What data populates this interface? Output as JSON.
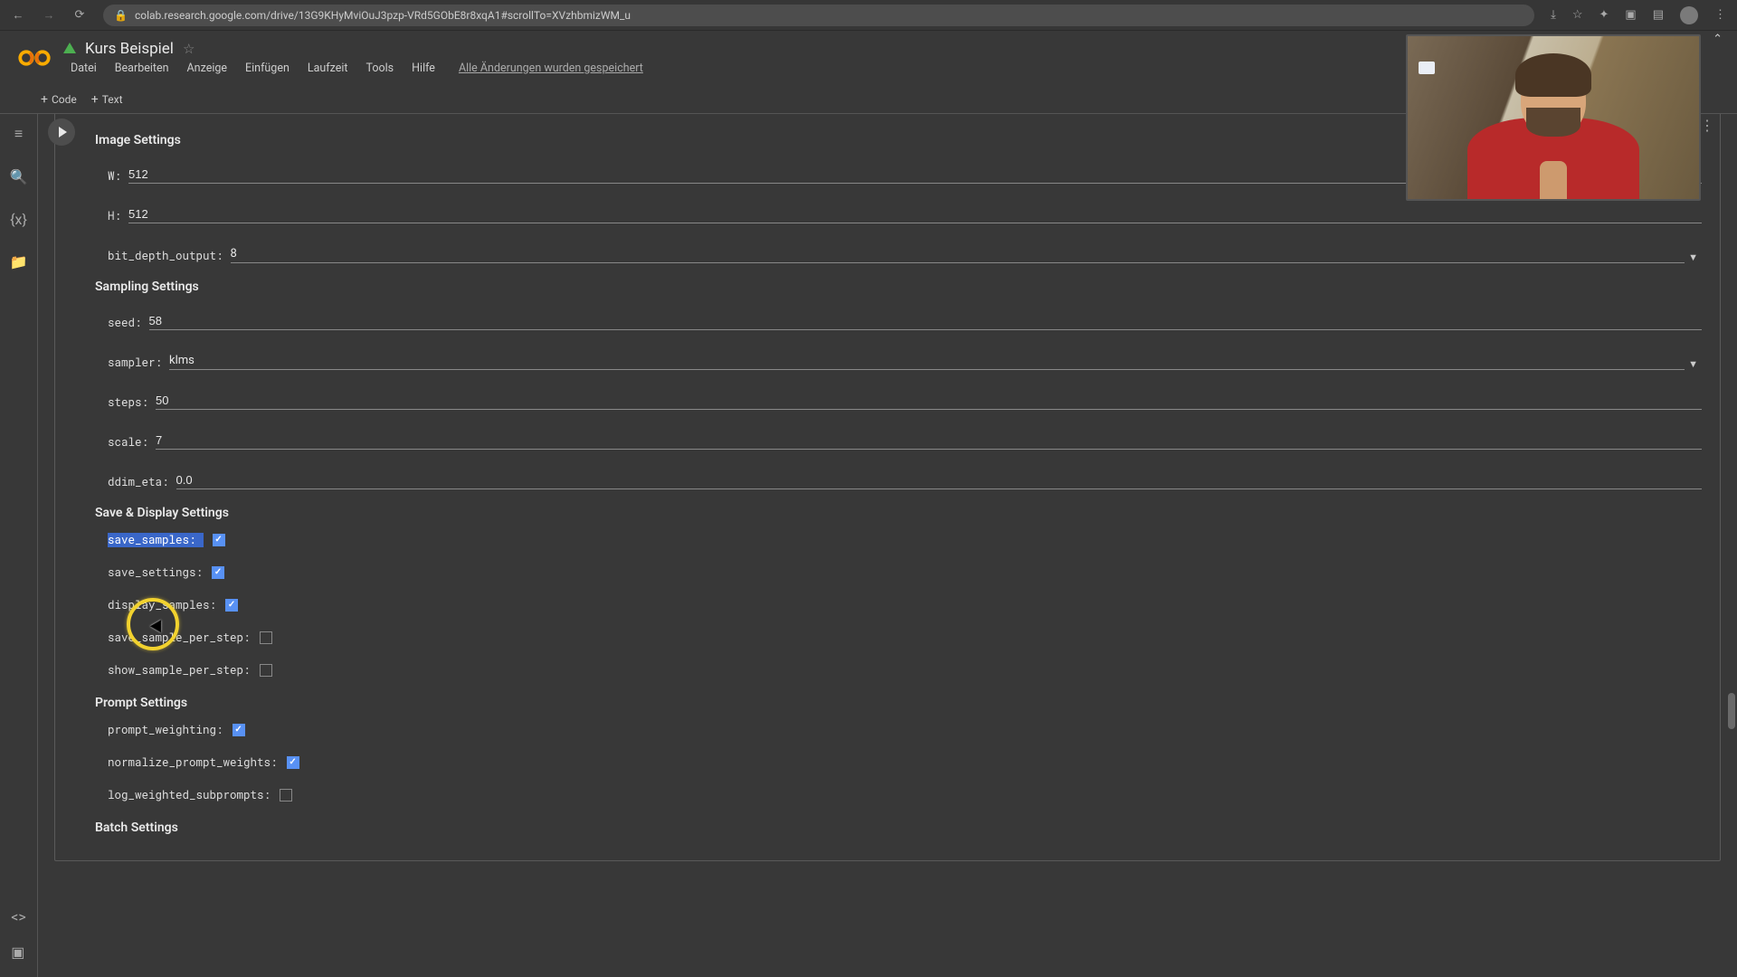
{
  "browser": {
    "url": "colab.research.google.com/drive/13G9KHyMviOuJ3pzp-VRd5GObE8r8xqA1#scrollTo=XVzhbmizWM_u"
  },
  "header": {
    "doc_title": "Kurs Beispiel",
    "menu": {
      "file": "Datei",
      "edit": "Bearbeiten",
      "view": "Anzeige",
      "insert": "Einfügen",
      "runtime": "Laufzeit",
      "tools": "Tools",
      "help": "Hilfe"
    },
    "save_status": "Alle Änderungen wurden gespeichert"
  },
  "toolbar": {
    "code_btn": "Code",
    "text_btn": "Text"
  },
  "sections": {
    "image": "Image Settings",
    "sampling": "Sampling Settings",
    "save_display": "Save & Display Settings",
    "prompt": "Prompt Settings",
    "batch": "Batch Settings"
  },
  "fields": {
    "W": {
      "label": "W:",
      "value": "512"
    },
    "H": {
      "label": "H:",
      "value": "512"
    },
    "bit_depth_output": {
      "label": "bit_depth_output:",
      "value": "8"
    },
    "seed": {
      "label": "seed:",
      "value": "58"
    },
    "sampler": {
      "label": "sampler:",
      "value": "klms"
    },
    "steps": {
      "label": "steps:",
      "value": "50"
    },
    "scale": {
      "label": "scale:",
      "value": "7"
    },
    "ddim_eta": {
      "label": "ddim_eta:",
      "value": "0.0"
    },
    "save_samples": {
      "label": "save_samples:",
      "checked": true
    },
    "save_settings": {
      "label": "save_settings:",
      "checked": true
    },
    "display_samples": {
      "label": "display_samples:",
      "checked": true
    },
    "save_sample_per_step": {
      "label": "save_sample_per_step:",
      "checked": false
    },
    "show_sample_per_step": {
      "label": "show_sample_per_step:",
      "checked": false
    },
    "prompt_weighting": {
      "label": "prompt_weighting:",
      "checked": true
    },
    "normalize_prompt_weights": {
      "label": "normalize_prompt_weights:",
      "checked": true
    },
    "log_weighted_subprompts": {
      "label": "log_weighted_subprompts:",
      "checked": false
    }
  }
}
